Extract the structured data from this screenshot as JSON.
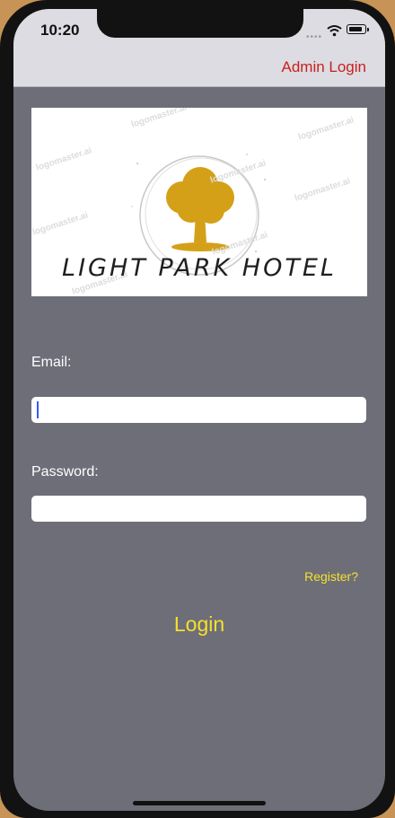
{
  "status_bar": {
    "time": "10:20",
    "signal_icon": "signal-dots-icon",
    "wifi_icon": "wifi-icon",
    "battery_icon": "battery-icon"
  },
  "nav": {
    "admin_login_label": "Admin Login"
  },
  "logo": {
    "hotel_name": "LIGHT PARK HOTEL",
    "watermark": "logomaster.ai",
    "tree_color": "#d4a017",
    "icon": "tree-icon"
  },
  "form": {
    "email_label": "Email:",
    "email_value": "",
    "password_label": "Password:",
    "password_value": ""
  },
  "actions": {
    "register_label": "Register?",
    "login_label": "Login"
  },
  "colors": {
    "background": "#6e6e79",
    "admin_link": "#c8201e",
    "accent": "#f5e12a"
  }
}
